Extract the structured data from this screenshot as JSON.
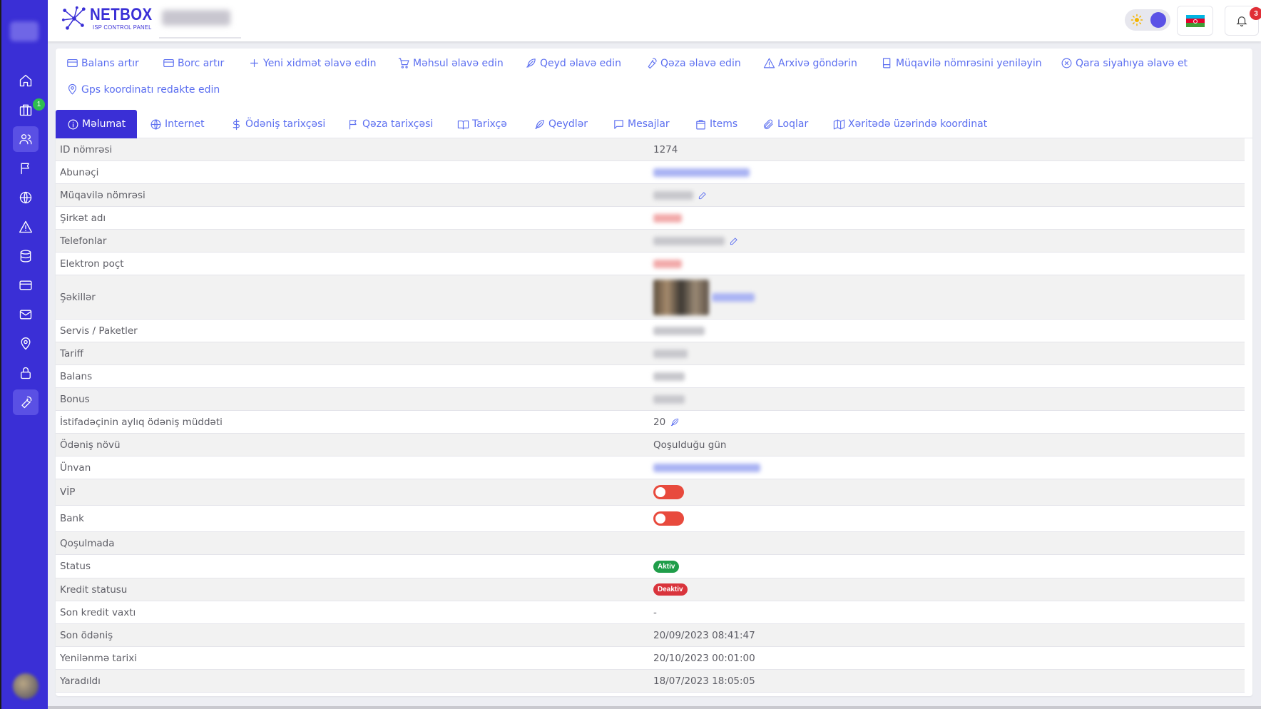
{
  "header": {
    "logo_name": "NETBOX",
    "logo_sub": "ISP CONTROL PANEL",
    "notification_count": "3"
  },
  "sidebar": {
    "badge_count": "1",
    "items": [
      "home",
      "packages",
      "users",
      "flag",
      "globe",
      "warning",
      "database",
      "card",
      "mail",
      "location",
      "lock",
      "wrench"
    ]
  },
  "actions": [
    {
      "label": "Balans artır",
      "icon": "card-icon"
    },
    {
      "label": "Borc artır",
      "icon": "card-icon"
    },
    {
      "label": "Yeni xidmət əlavə edin",
      "icon": "plus-icon"
    },
    {
      "label": "Məhsul əlavə edin",
      "icon": "cart-icon"
    },
    {
      "label": "Qeyd əlavə edin",
      "icon": "feather-icon"
    },
    {
      "label": "Qəza əlavə edin",
      "icon": "wrench-icon"
    },
    {
      "label": "Arxivə göndərin",
      "icon": "warning-icon"
    },
    {
      "label": "Müqavilə nömrəsini yeniləyin",
      "icon": "book-icon"
    },
    {
      "label": "Qara siyahıya əlavə et",
      "icon": "x-circle-icon"
    },
    {
      "label": "Gps koordinatı redakte edin",
      "icon": "pin-icon"
    }
  ],
  "tabs": [
    {
      "label": "Məlumat",
      "active": true
    },
    {
      "label": "Internet"
    },
    {
      "label": "Ödəniş tarixçəsi"
    },
    {
      "label": "Qəza tarixçəsi"
    },
    {
      "label": "Tarixçə"
    },
    {
      "label": "Qeydlər"
    },
    {
      "label": "Mesajlar"
    },
    {
      "label": "Items"
    },
    {
      "label": "Loqlar"
    },
    {
      "label": "Xəritədə üzərində koordinat"
    }
  ],
  "info": {
    "rows": [
      {
        "label": "ID nömrəsi",
        "value": "1274"
      },
      {
        "label": "Abunəçi",
        "value": ""
      },
      {
        "label": "Müqavilə nömrəsi",
        "value": ""
      },
      {
        "label": "Şirkət adı",
        "value": ""
      },
      {
        "label": "Telefonlar",
        "value": ""
      },
      {
        "label": "Elektron poçt",
        "value": ""
      },
      {
        "label": "Şəkillər",
        "value": ""
      },
      {
        "label": "Servis / Paketler",
        "value": ""
      },
      {
        "label": "Tariff",
        "value": ""
      },
      {
        "label": "Balans",
        "value": ""
      },
      {
        "label": "Bonus",
        "value": ""
      },
      {
        "label": "İstifadəçinin aylıq ödəniş müddəti",
        "value": "20"
      },
      {
        "label": "Ödəniş növü",
        "value": "Qoşulduğu gün"
      },
      {
        "label": "Ünvan",
        "value": ""
      },
      {
        "label": "VİP",
        "value": "off"
      },
      {
        "label": "Bank",
        "value": "off"
      },
      {
        "label": "Qoşulmada",
        "value": ""
      },
      {
        "label": "Status",
        "value": "Aktiv"
      },
      {
        "label": "Kredit statusu",
        "value": "Deaktiv"
      },
      {
        "label": "Son kredit vaxtı",
        "value": "-"
      },
      {
        "label": "Son ödəniş",
        "value": "20/09/2023 08:41:47"
      },
      {
        "label": "Yenilənmə tarixi",
        "value": "20/10/2023 00:01:00"
      },
      {
        "label": "Yaradıldı",
        "value": "18/07/2023 18:05:05"
      }
    ]
  },
  "colors": {
    "primary": "#3a2fd6",
    "link": "#5c6ff0",
    "toggle_off": "#e84a3d",
    "badge_active": "#1f9d49",
    "badge_inactive": "#d9343c"
  }
}
